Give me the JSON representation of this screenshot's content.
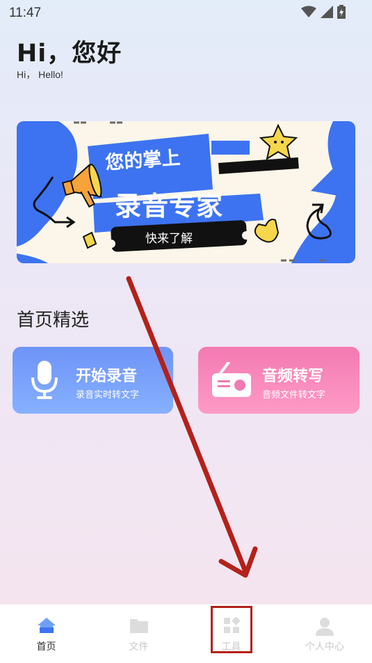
{
  "status": {
    "time": "11:47"
  },
  "greeting": {
    "title": "Hi，您好",
    "subtitle": "Hi， Hello!"
  },
  "banner": {
    "line1": "您的掌上",
    "line2": "录音专家",
    "cta": "快来了解"
  },
  "section": {
    "title": "首页精选"
  },
  "cards": [
    {
      "title": "开始录音",
      "subtitle": "录音实时转文字",
      "icon": "microphone-icon"
    },
    {
      "title": "音频转写",
      "subtitle": "音频文件转文字",
      "icon": "radio-icon"
    }
  ],
  "tabs": [
    {
      "label": "首页",
      "icon": "home-icon",
      "active": true
    },
    {
      "label": "文件",
      "icon": "folder-icon",
      "active": false
    },
    {
      "label": "工具",
      "icon": "tools-icon",
      "active": false
    },
    {
      "label": "个人中心",
      "icon": "person-icon",
      "active": false
    }
  ],
  "colors": {
    "accent": "#3d73f1",
    "record_card": "#6e94f7",
    "transcribe_card": "#f27ab2",
    "annotation": "#b3211a"
  }
}
